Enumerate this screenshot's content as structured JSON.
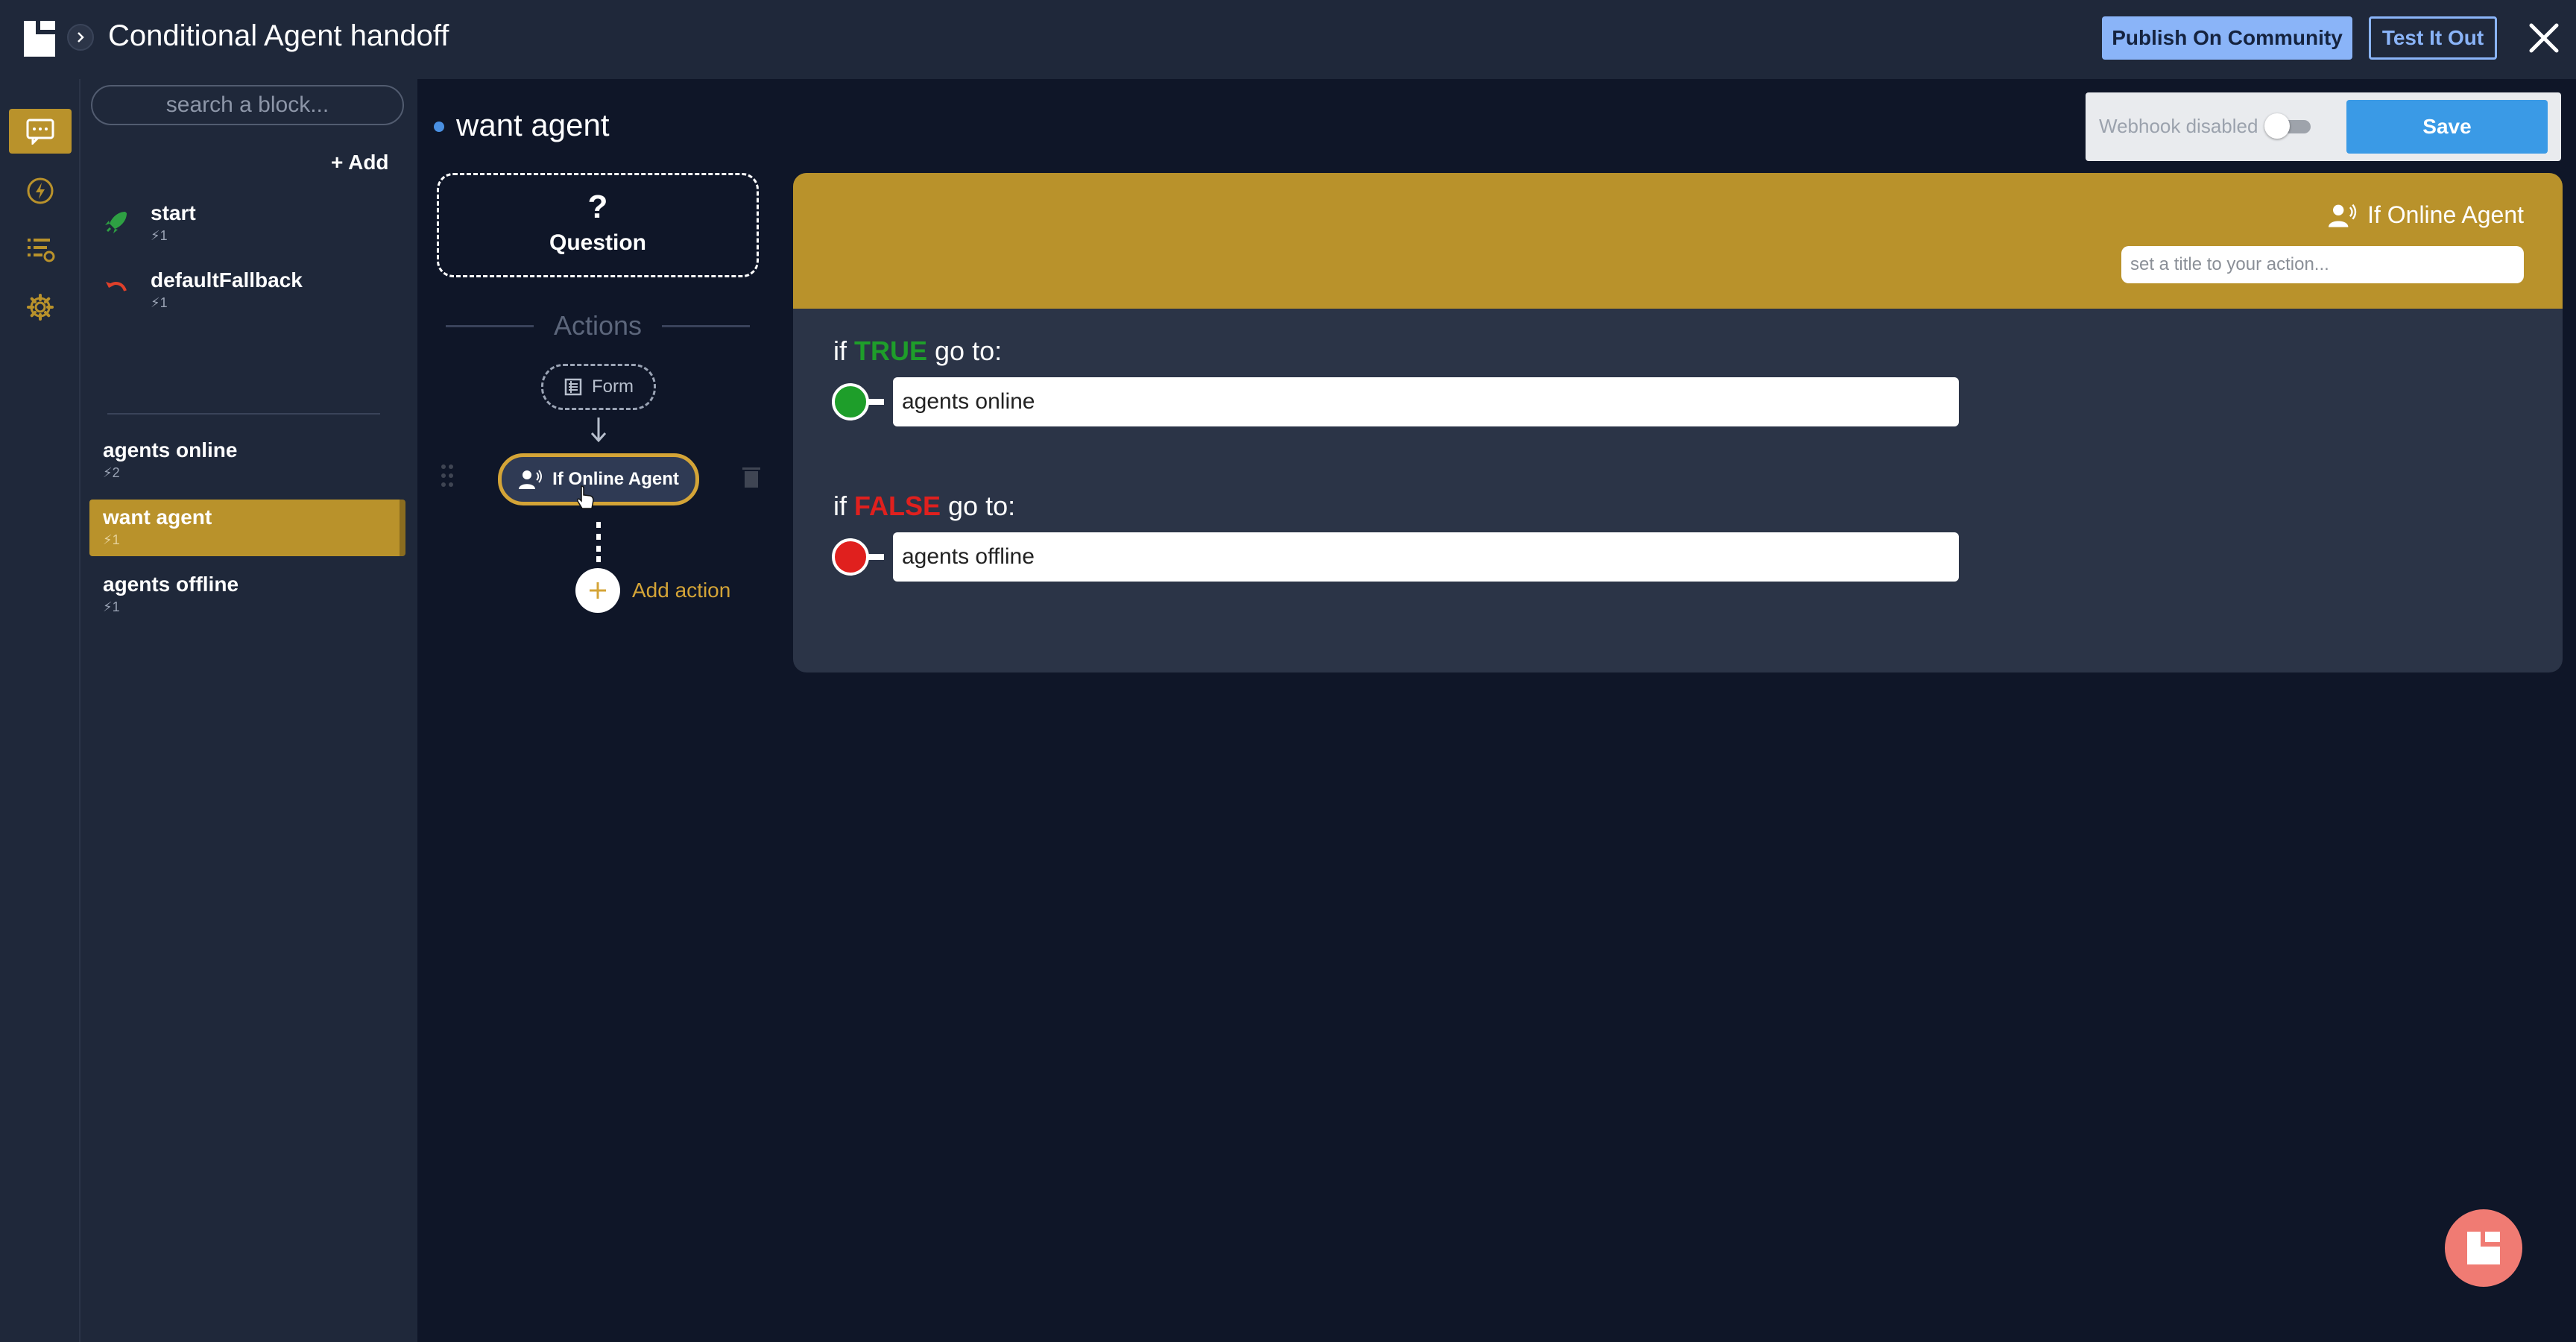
{
  "header": {
    "title": "Conditional Agent handoff",
    "publish_label": "Publish On Community",
    "test_label": "Test It Out"
  },
  "rail": {
    "items": [
      "chat-icon",
      "bolt-icon",
      "list-settings-icon",
      "gear-icon"
    ],
    "active": "chat-icon"
  },
  "blocks": {
    "search_placeholder": "search a block...",
    "add_label": "+ Add",
    "items": [
      {
        "name": "start",
        "meta": "⚡1",
        "icon": "rocket-icon"
      },
      {
        "name": "defaultFallback",
        "meta": "⚡1",
        "icon": "undo-icon"
      },
      {
        "name": "agents online",
        "meta": "⚡2"
      },
      {
        "name": "want agent",
        "meta": "⚡1",
        "active": true
      },
      {
        "name": "agents offline",
        "meta": "⚡1"
      }
    ]
  },
  "block": {
    "title": "want agent",
    "question_mark": "?",
    "question_label": "Question",
    "actions_label": "Actions",
    "actions": [
      {
        "label": "Form",
        "icon": "form-icon"
      },
      {
        "label": "If Online Agent",
        "icon": "agent-icon",
        "selected": true
      }
    ],
    "add_action_label": "Add action"
  },
  "toolbar": {
    "webhook_label": "Webhook disabled",
    "webhook_enabled": false,
    "save_label": "Save"
  },
  "detail": {
    "type_label": "If Online Agent",
    "title_placeholder": "set a title to your action...",
    "true_prefix": "if ",
    "true_keyword": "TRUE",
    "true_suffix": " go to:",
    "true_target": "agents online",
    "false_prefix": "if ",
    "false_keyword": "FALSE",
    "false_suffix": " go to:",
    "false_target": "agents offline"
  },
  "colors": {
    "accent": "#b9922b",
    "primary": "#8ab4f8",
    "save": "#3a9ae6",
    "true": "#1e9e2a",
    "false": "#e0201e",
    "fab": "#f07b73"
  }
}
